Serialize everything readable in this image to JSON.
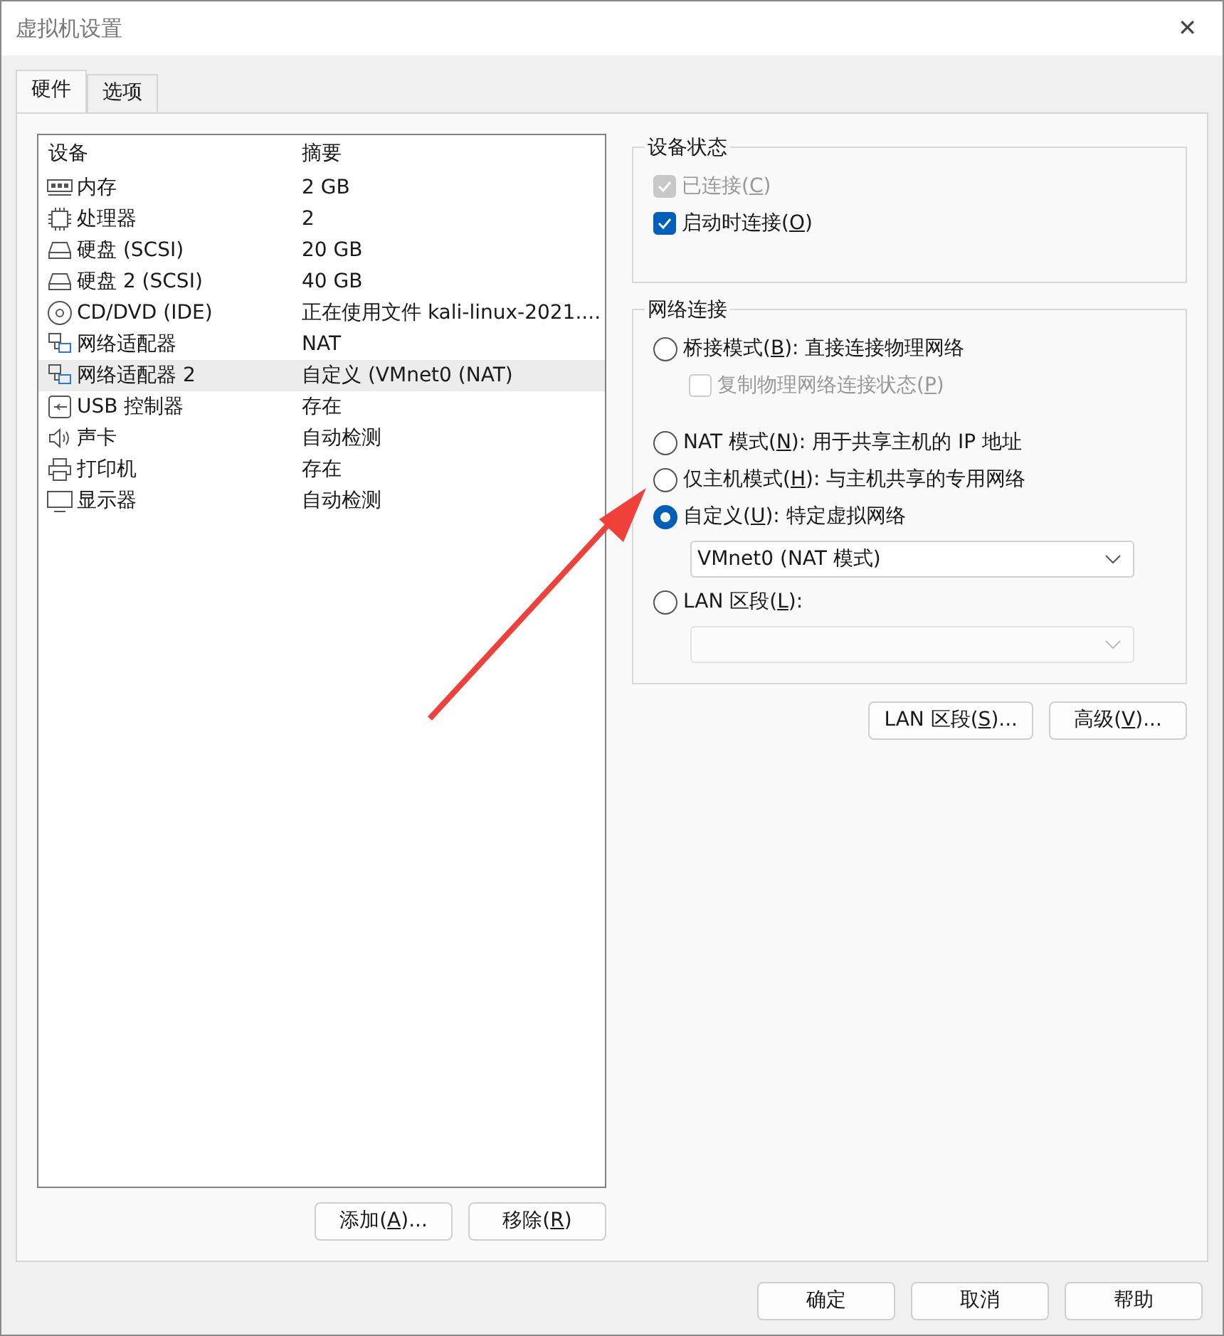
{
  "window": {
    "title": "虚拟机设置",
    "close": "✕"
  },
  "tabs": [
    {
      "label": "硬件",
      "selected": true
    },
    {
      "label": "选项",
      "selected": false
    }
  ],
  "device_list": {
    "columns": [
      "设备",
      "摘要"
    ],
    "rows": [
      {
        "kind": "memory",
        "device": "内存",
        "summary": "2 GB",
        "selected": false
      },
      {
        "kind": "cpu",
        "device": "处理器",
        "summary": "2",
        "selected": false
      },
      {
        "kind": "disk",
        "device": "硬盘 (SCSI)",
        "summary": "20 GB",
        "selected": false
      },
      {
        "kind": "disk",
        "device": "硬盘 2 (SCSI)",
        "summary": "40 GB",
        "selected": false
      },
      {
        "kind": "cd",
        "device": "CD/DVD (IDE)",
        "summary": "正在使用文件 kali-linux-2021....",
        "selected": false
      },
      {
        "kind": "network",
        "device": "网络适配器",
        "summary": "NAT",
        "selected": false
      },
      {
        "kind": "network",
        "device": "网络适配器 2",
        "summary": "自定义 (VMnet0 (NAT)",
        "selected": true
      },
      {
        "kind": "usb",
        "device": "USB 控制器",
        "summary": "存在",
        "selected": false
      },
      {
        "kind": "sound",
        "device": "声卡",
        "summary": "自动检测",
        "selected": false
      },
      {
        "kind": "printer",
        "device": "打印机",
        "summary": "存在",
        "selected": false
      },
      {
        "kind": "monitor",
        "device": "显示器",
        "summary": "自动检测",
        "selected": false
      }
    ],
    "buttons": [
      {
        "parts": [
          "添加(",
          "A",
          ")..."
        ]
      },
      {
        "parts": [
          "移除(",
          "R",
          ")"
        ]
      }
    ]
  },
  "device_status": {
    "title": "设备状态",
    "items": [
      {
        "parts": [
          "已连接(",
          "C",
          ")"
        ],
        "checked": true,
        "disabled": true
      },
      {
        "parts": [
          "启动时连接(",
          "O",
          ")"
        ],
        "checked": true,
        "disabled": false
      }
    ]
  },
  "network_connection": {
    "title": "网络连接",
    "items": [
      {
        "kind": "radio",
        "parts": [
          "桥接模式(",
          "B",
          "): 直接连接物理网络"
        ],
        "selected": false
      },
      {
        "kind": "checkbox",
        "parts": [
          "复制物理网络连接状态(",
          "P",
          ")"
        ],
        "checked": false,
        "disabled": true
      },
      {
        "kind": "radio",
        "parts": [
          "NAT 模式(",
          "N",
          "): 用于共享主机的 IP 地址"
        ],
        "selected": false
      },
      {
        "kind": "radio",
        "parts": [
          "仅主机模式(",
          "H",
          "): 与主机共享的专用网络"
        ],
        "selected": false
      },
      {
        "kind": "radio",
        "parts": [
          "自定义(",
          "U",
          "): 特定虚拟网络"
        ],
        "selected": true
      },
      {
        "kind": "select",
        "value": "VMnet0 (NAT 模式)",
        "disabled": false
      },
      {
        "kind": "radio",
        "parts": [
          "LAN 区段(",
          "L",
          "):"
        ],
        "selected": false
      },
      {
        "kind": "select",
        "disabled": true
      }
    ],
    "buttons": [
      {
        "parts": [
          "LAN 区段(",
          "S",
          ")..."
        ]
      },
      {
        "parts": [
          "高级(",
          "V",
          ")..."
        ]
      }
    ]
  },
  "footer_buttons": [
    {
      "label": "确定"
    },
    {
      "label": "取消"
    },
    {
      "label": "帮助"
    }
  ]
}
